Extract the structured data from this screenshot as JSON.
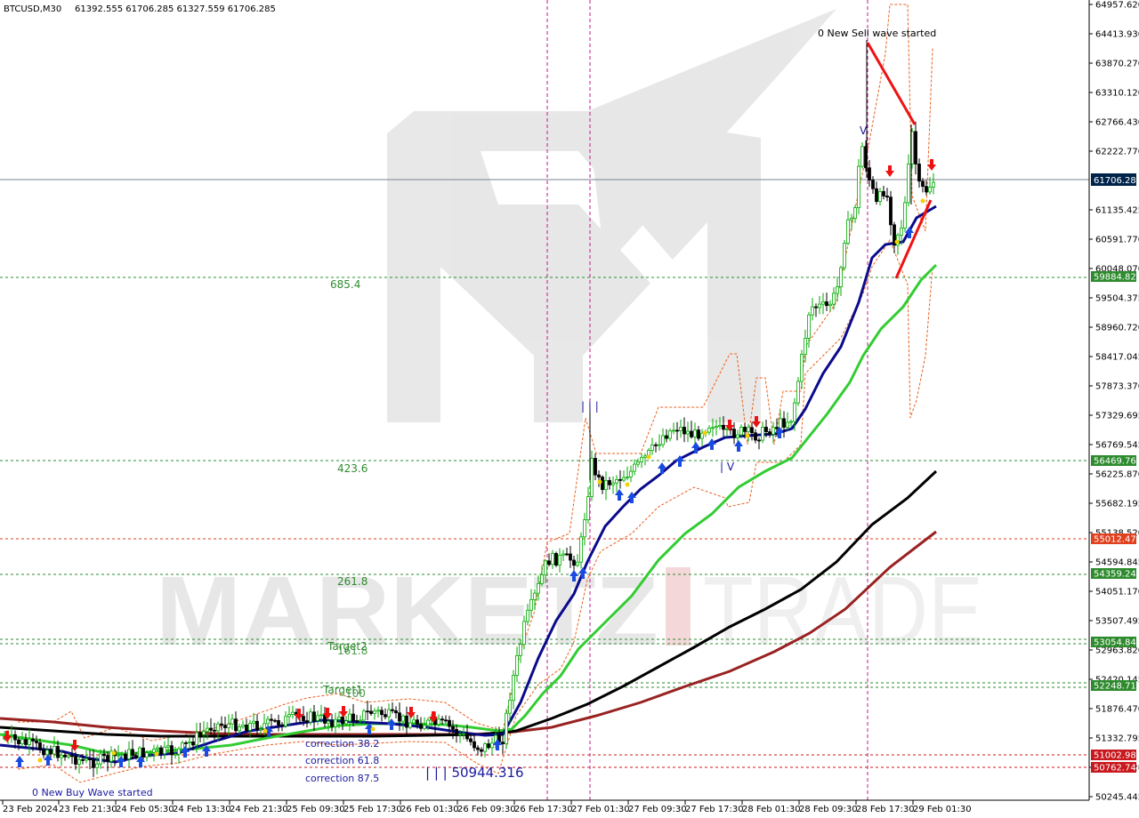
{
  "header": {
    "symbol": "BTCUSD,M30",
    "ohlc": "61392.555 61706.285 61327.559 61706.285"
  },
  "watermark": {
    "left": "MARKETZ",
    "right": "TRADE"
  },
  "annotations": {
    "sell_wave": "0 New Sell wave started",
    "buy_wave": "0 New Buy Wave started",
    "low_value": "| | | 50944.316",
    "wave_marker_1": "| | |",
    "wave_marker_4": "| V",
    "target1": "Target1",
    "target2": "Target2"
  },
  "fib_labels": [
    {
      "text": "685.4",
      "price": 59884.825
    },
    {
      "text": "423.6",
      "price": 56469.767
    },
    {
      "text": "261.8",
      "price": 54359.243
    },
    {
      "text": "161.8",
      "price": 53054.84
    },
    {
      "text": "100",
      "price": 52248.715
    }
  ],
  "corrections": [
    "correction 38.2",
    "correction 61.8",
    "correction 87.5"
  ],
  "price_axis": {
    "ticks": [
      "64957.620",
      "64413.930",
      "63870.270",
      "63310.120",
      "62766.430",
      "62222.770",
      "61135.425",
      "60591.770",
      "60048.070",
      "59504.375",
      "58960.720",
      "58417.045",
      "57873.370",
      "57329.695",
      "56769.545",
      "56225.870",
      "55682.195",
      "55138.520",
      "54594.845",
      "54051.170",
      "53507.495",
      "52963.820",
      "52420.145",
      "51876.470",
      "51332.795",
      "50789.120",
      "50245.445"
    ],
    "current": "61706.285",
    "levels": [
      {
        "label": "59884.825",
        "color": "#2e8b2e"
      },
      {
        "label": "56469.767",
        "color": "#2e8b2e"
      },
      {
        "label": "55012.474",
        "color": "#e0401e"
      },
      {
        "label": "54359.243",
        "color": "#2e8b2e"
      },
      {
        "label": "53054.840",
        "color": "#2e8b2e"
      },
      {
        "label": "52248.715",
        "color": "#2e8b2e"
      },
      {
        "label": "51002.984",
        "color": "#c8191e"
      },
      {
        "label": "50762.743",
        "color": "#c8191e"
      }
    ]
  },
  "time_axis": [
    "23 Feb 2024",
    "23 Feb 21:30",
    "24 Feb 05:30",
    "24 Feb 13:30",
    "24 Feb 21:30",
    "25 Feb 09:30",
    "25 Feb 17:30",
    "26 Feb 01:30",
    "26 Feb 09:30",
    "26 Feb 17:30",
    "27 Feb 01:30",
    "27 Feb 09:30",
    "27 Feb 17:30",
    "28 Feb 01:30",
    "28 Feb 09:30",
    "28 Feb 17:30",
    "29 Feb 01:30"
  ],
  "chart_data": {
    "type": "candlestick",
    "symbol": "BTCUSD",
    "timeframe": "M30",
    "last_close": 61706.285,
    "ylim": [
      50245.445,
      64957.62
    ],
    "y_scale_units": "USD",
    "visible_high_approx": 64400,
    "visible_low_approx": 50944.316,
    "lines": [
      "moving average blue",
      "moving average green",
      "moving average black",
      "moving average dark red",
      "price channel orange dashed"
    ]
  },
  "colors": {
    "bull": "#00aa00",
    "bear": "#000000",
    "fib_green": "#2e8b2e",
    "target_red": "#e0401e",
    "ma_blue": "#0a0a8c",
    "ma_green": "#33cc33",
    "ma_black": "#000000",
    "ma_red": "#992222",
    "vline": "#c0198c",
    "current_tag_bg": "#00234a"
  }
}
